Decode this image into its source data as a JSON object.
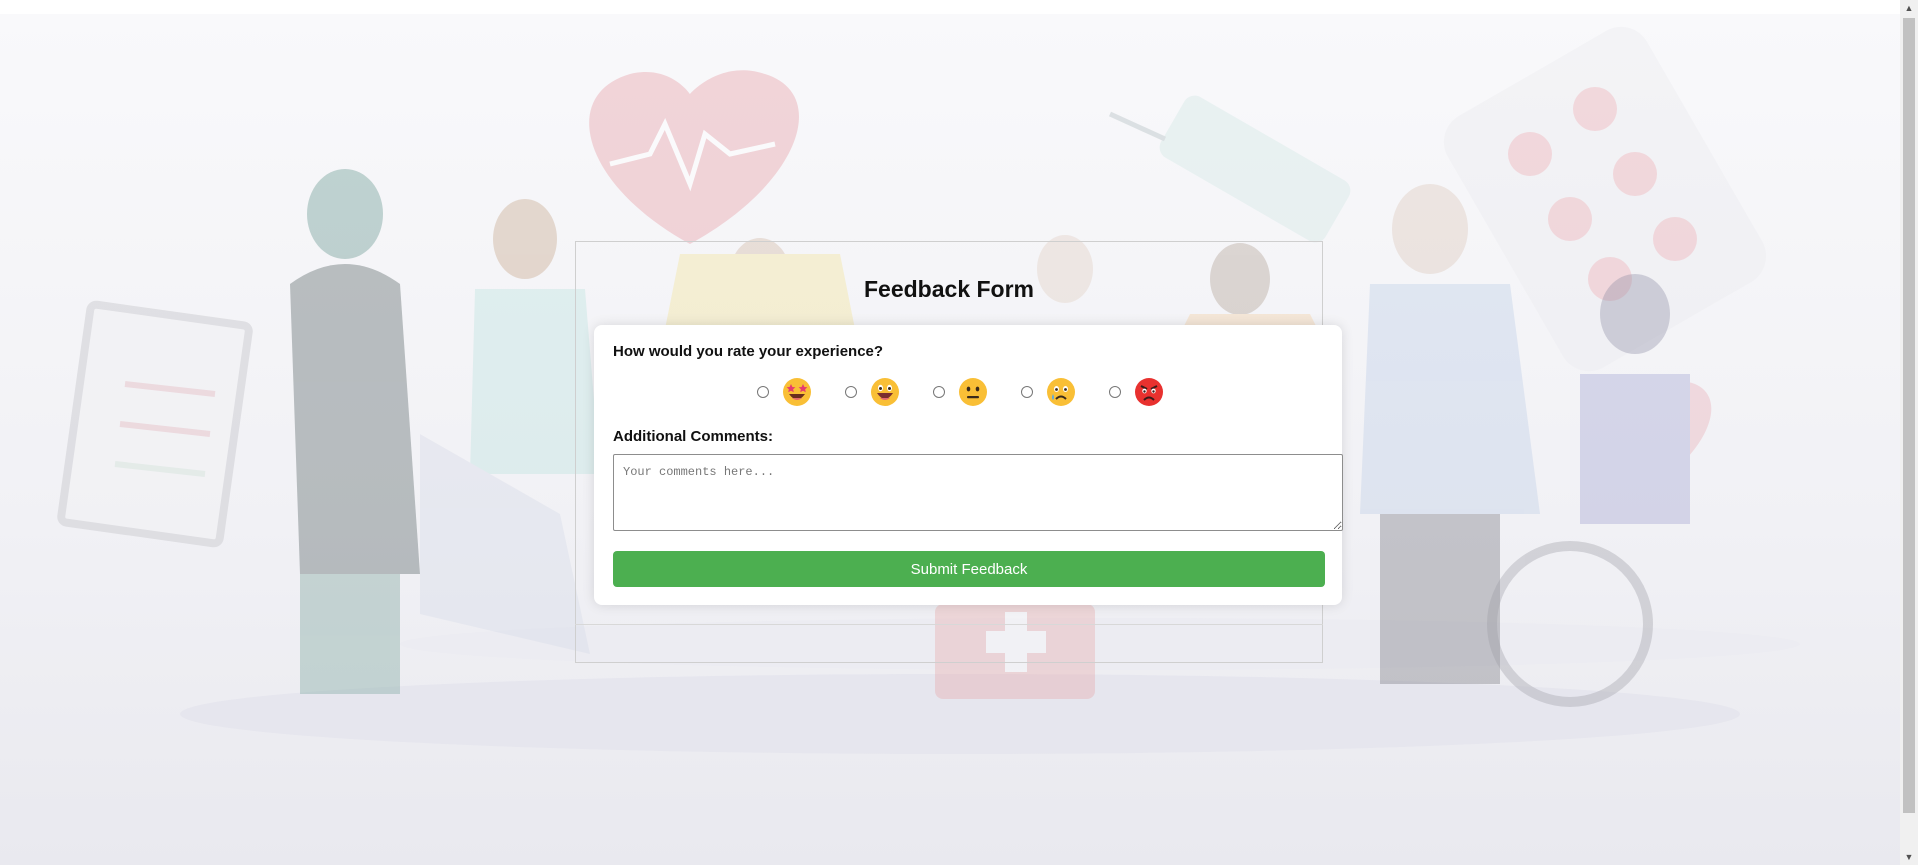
{
  "form": {
    "title": "Feedback Form",
    "question": "How would you rate your experience?",
    "ratings": [
      {
        "icon": "star-struck-emoji-icon",
        "selected": false
      },
      {
        "icon": "grinning-emoji-icon",
        "selected": false
      },
      {
        "icon": "neutral-emoji-icon",
        "selected": false
      },
      {
        "icon": "sad-tear-emoji-icon",
        "selected": false
      },
      {
        "icon": "angry-emoji-icon",
        "selected": false
      }
    ],
    "comments_label": "Additional Comments:",
    "comments_placeholder": "Your comments here...",
    "comments_value": "",
    "submit_label": "Submit Feedback"
  },
  "colors": {
    "submit": "#4caf50",
    "background": "#f4f4f7"
  }
}
